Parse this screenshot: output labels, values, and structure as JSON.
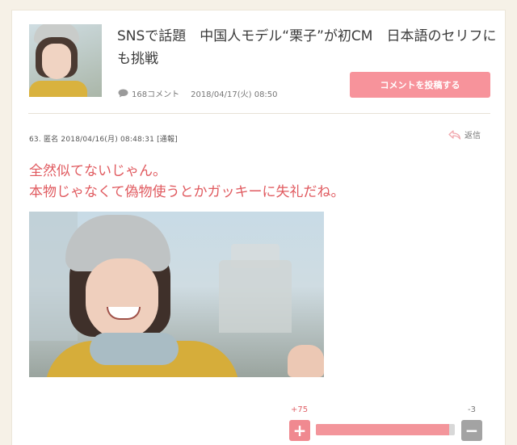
{
  "article": {
    "title": "SNSで話題　中国人モデル“栗子”が初CM　日本語のセリフにも挑戦",
    "comment_count": "168コメント",
    "date": "2018/04/17(火) 08:50",
    "post_button": "コメントを投稿する"
  },
  "comment": {
    "meta": "63. 匿名 2018/04/16(月) 08:48:31 [通報]",
    "reply_label": "返信",
    "lines": [
      "全然似てないじゃん。",
      "本物じゃなくて偽物使うとかガッキーに失礼だね。"
    ]
  },
  "votes": {
    "plus": "+75",
    "minus": "-3",
    "plus_button": "+",
    "minus_button": "−",
    "positive_ratio": 0.96
  },
  "colors": {
    "accent": "#f7939b",
    "comment_text": "#e05a5f",
    "background": "#f6f1e7"
  },
  "icons": {
    "comment": "speech-bubble-icon",
    "reply": "reply-arrow-icon"
  }
}
